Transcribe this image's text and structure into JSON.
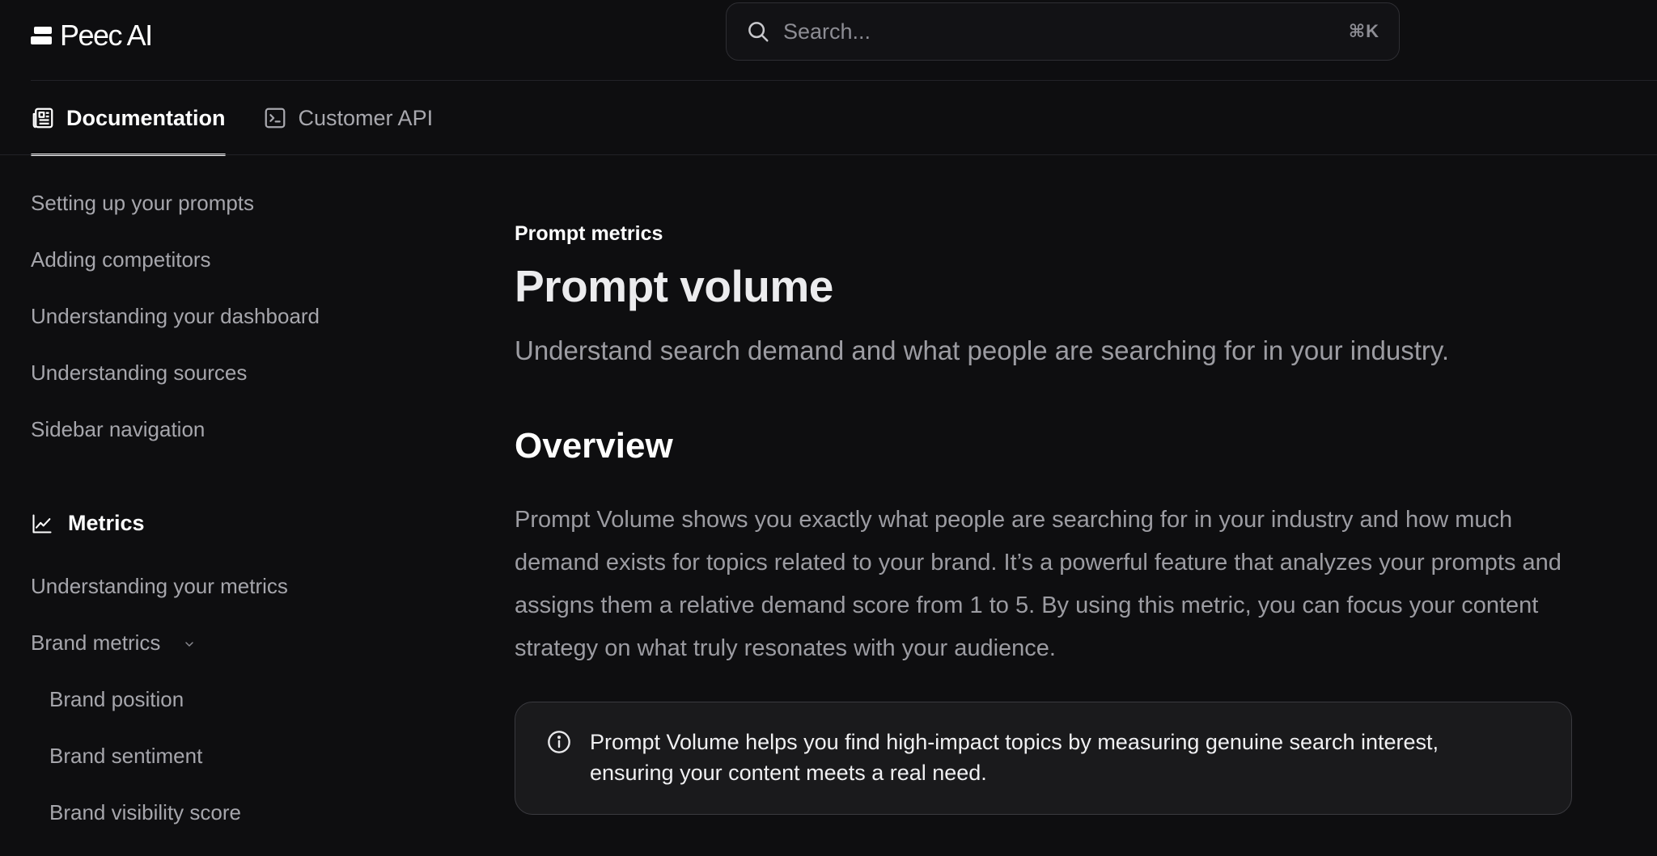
{
  "app": {
    "brand": "Peec AI"
  },
  "search": {
    "placeholder": "Search...",
    "shortcut": "⌘K"
  },
  "tabs": [
    {
      "label": "Documentation",
      "active": true,
      "icon": "newspaper-icon"
    },
    {
      "label": "Customer API",
      "active": false,
      "icon": "terminal-icon"
    }
  ],
  "sidebar": {
    "items": [
      "Setting up your prompts",
      "Adding competitors",
      "Understanding your dashboard",
      "Understanding sources",
      "Sidebar navigation"
    ],
    "metrics_heading": "Metrics",
    "metrics_items": {
      "understanding": "Understanding your metrics",
      "brand_metrics": "Brand metrics",
      "brand_position": "Brand position",
      "brand_sentiment": "Brand sentiment",
      "brand_visibility": "Brand visibility score"
    }
  },
  "page": {
    "eyebrow": "Prompt metrics",
    "title": "Prompt volume",
    "subtitle": "Understand search demand and what people are searching for in your industry.",
    "overview_heading": "Overview",
    "overview_text": "Prompt Volume shows you exactly what people are searching for in your industry and how much demand exists for topics related to your brand. It’s a powerful feature that analyzes your prompts and assigns them a relative demand score from 1 to 5. By using this metric, you can focus your content strategy on what truly resonates with your audience.",
    "callout_text": "Prompt Volume helps you find high-impact topics by measuring genuine search interest, ensuring your content meets a real need."
  },
  "colors": {
    "background": "#0e0e10",
    "text_primary": "#ffffff",
    "text_muted": "#9c9ca2",
    "border": "#3a3a3f"
  }
}
